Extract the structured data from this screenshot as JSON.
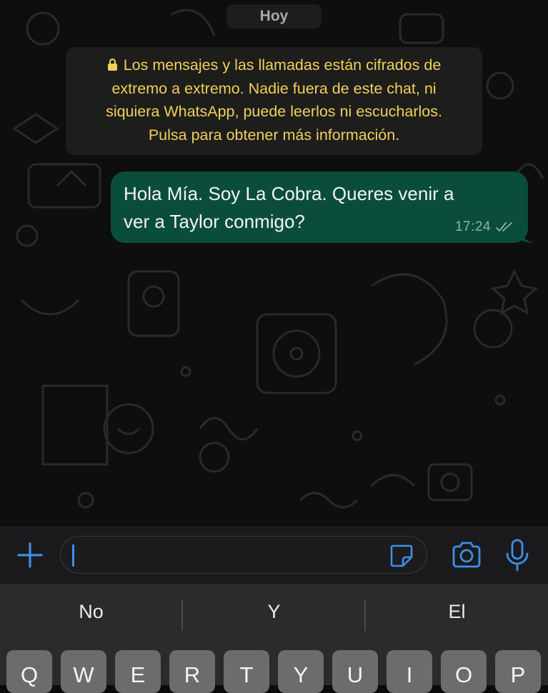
{
  "chat": {
    "date_chip": "Hoy",
    "encryption_notice": {
      "lines": [
        "Los mensajes y las llamadas están cifrados de",
        "extremo a extremo. Nadie fuera de este chat, ni",
        "siquiera WhatsApp, puede leerlos ni escucharlos.",
        "Pulsa para obtener más información."
      ],
      "icon": "lock-icon"
    },
    "messages": [
      {
        "direction": "outgoing",
        "lines": [
          "Hola Mía. Soy La Cobra. Queres venir a",
          "ver a Taylor conmigo?"
        ],
        "time": "17:24",
        "status": "delivered"
      }
    ]
  },
  "input_bar": {
    "value": "",
    "icons": [
      "plus-icon",
      "sticker-icon",
      "camera-icon",
      "microphone-icon"
    ]
  },
  "keyboard": {
    "suggestions": [
      "No",
      "Y",
      "El"
    ],
    "keys": [
      "Q",
      "W",
      "E",
      "R",
      "T",
      "Y",
      "U",
      "I",
      "O",
      "P"
    ]
  },
  "colors": {
    "outgoing_bubble": "#0b4d3c",
    "notice_text": "#f1cf5b",
    "accent_blue": "#3d8fe6",
    "chat_background": "#0e0e0e"
  }
}
